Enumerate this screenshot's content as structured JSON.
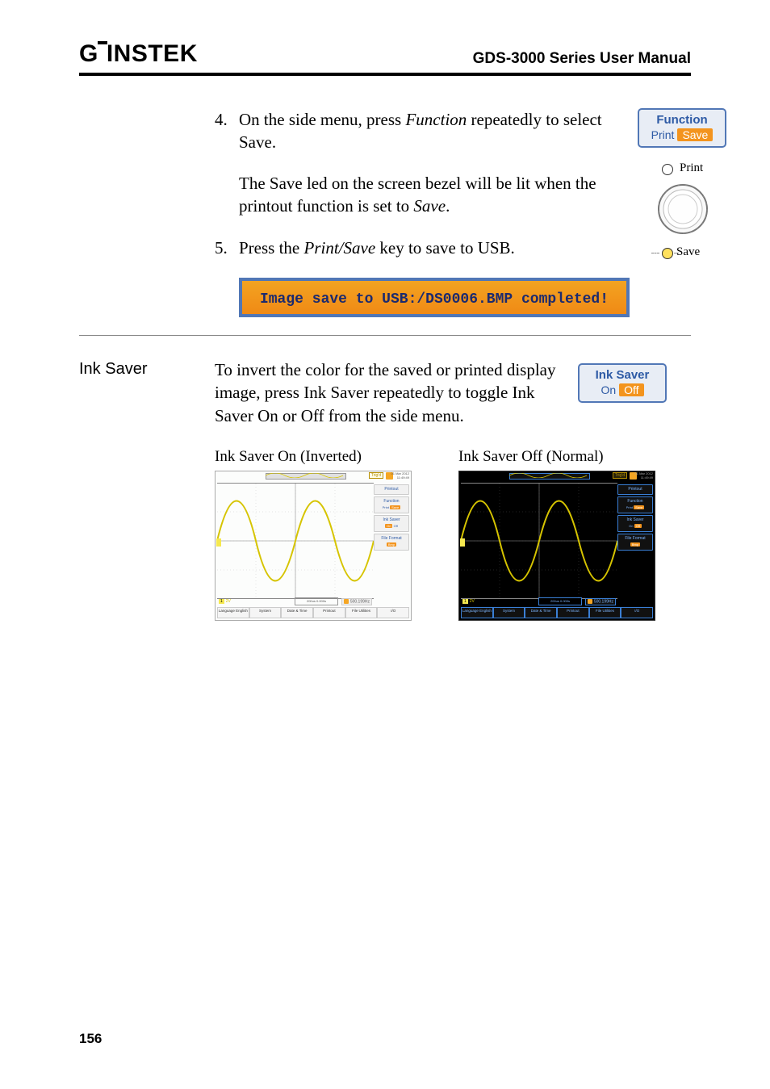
{
  "header": {
    "brand_prefix": "G",
    "brand_suffix": "INSTEK",
    "manual_title": "GDS-3000 Series User Manual"
  },
  "step4": {
    "num": "4.",
    "pre": "On the side menu, press ",
    "italic": "Function",
    "post": " repeatedly to select Save."
  },
  "step4_note": {
    "pre": "The Save led on the screen bezel will be lit when the printout function is set to ",
    "italic": "Save",
    "post": "."
  },
  "step5": {
    "num": "5.",
    "pre": "Press the ",
    "italic": "Print/Save",
    "post": " key to save to USB."
  },
  "softkey_function": {
    "title": "Function",
    "opt1": "Print",
    "opt2": "Save"
  },
  "softkey_inksaver": {
    "title": "Ink Saver",
    "opt1": "On",
    "opt2": "Off"
  },
  "dial": {
    "print": "Print",
    "save": "Save"
  },
  "msg_bar": "Image save to USB:/DS0006.BMP completed!",
  "ink_saver": {
    "heading": "Ink Saver",
    "body": "To invert the color for the saved or printed display image, press Ink Saver repeatedly to toggle Ink Saver On or Off from the side menu."
  },
  "shot_labels": {
    "on": "Ink Saver On (Inverted)",
    "off": "Ink Saver Off (Normal)"
  },
  "scope": {
    "date1": "01 Mar 2012",
    "time1": "11:49:49",
    "trig": "Trig'd",
    "ch_label": "1",
    "ch_scale": "2V",
    "timebase": "200us   0.000s",
    "rate": "500.199Hz",
    "side_menu": [
      "Printout",
      "Function",
      "Ink Saver",
      "File Format"
    ],
    "side_detail": {
      "function_opts": "Print  Save",
      "inksaver_on": "On    Off",
      "inksaver_off": "On    Off",
      "fileformat": "Bmp"
    },
    "bottom_tabs": [
      "Language English",
      "System",
      "Date & Time",
      "Printout",
      "File Utilities",
      "I/O"
    ]
  },
  "page_number": "156"
}
